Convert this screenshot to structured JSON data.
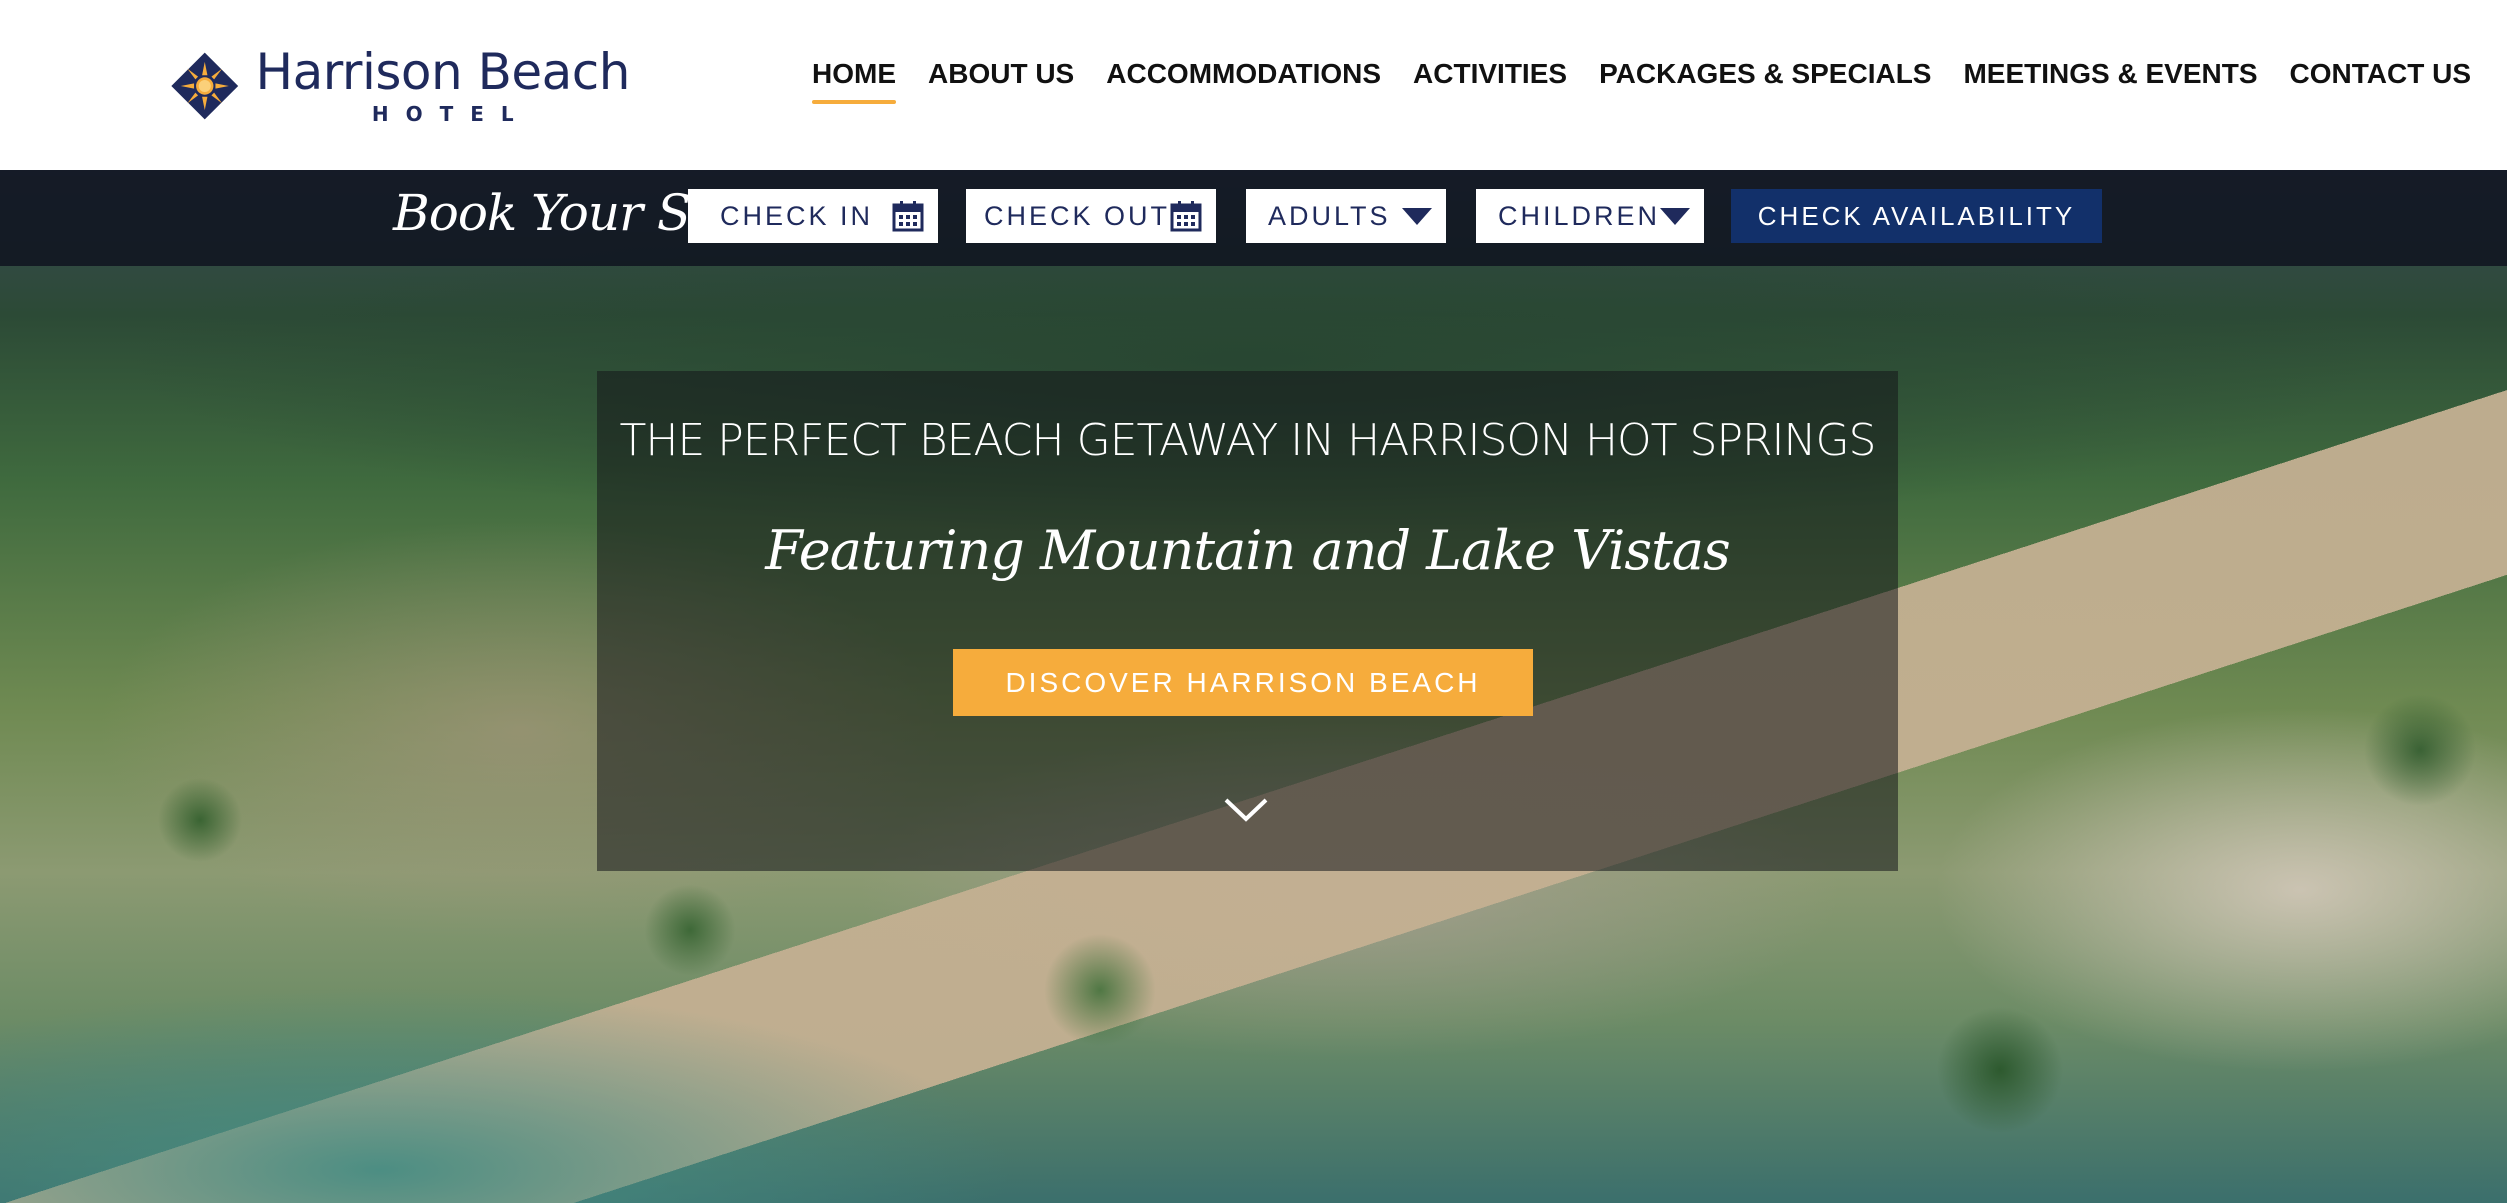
{
  "logo": {
    "name": "Harrison Beach",
    "sub": "HOTEL",
    "icon": "sun-diamond-logo",
    "colors": {
      "navy": "#1f2a5c",
      "sun": "#f6ac3c"
    }
  },
  "nav": {
    "items": [
      {
        "label": "HOME",
        "active": true
      },
      {
        "label": "ABOUT US"
      },
      {
        "label": "ACCOMMODATIONS"
      },
      {
        "label": "ACTIVITIES"
      },
      {
        "label": "PACKAGES & SPECIALS"
      },
      {
        "label": "MEETINGS & EVENTS"
      },
      {
        "label": "CONTACT US"
      }
    ],
    "active_color": "#f6ac3c"
  },
  "booking": {
    "title": "Book Your Stay",
    "check_in": "CHECK IN",
    "check_out": "CHECK OUT",
    "adults": "ADULTS",
    "children": "CHILDREN",
    "check_availability": "CHECK AVAILABILITY",
    "icons": {
      "date": "calendar-icon",
      "select": "caret-down-icon"
    },
    "button_color": "#12306a"
  },
  "hero": {
    "headline": "THE PERFECT BEACH GETAWAY IN HARRISON HOT SPRINGS",
    "subline": "Featuring Mountain and Lake Vistas",
    "cta": "DISCOVER HARRISON BEACH",
    "cta_color": "#f6ac3c",
    "scroll_icon": "chevron-down-icon"
  }
}
